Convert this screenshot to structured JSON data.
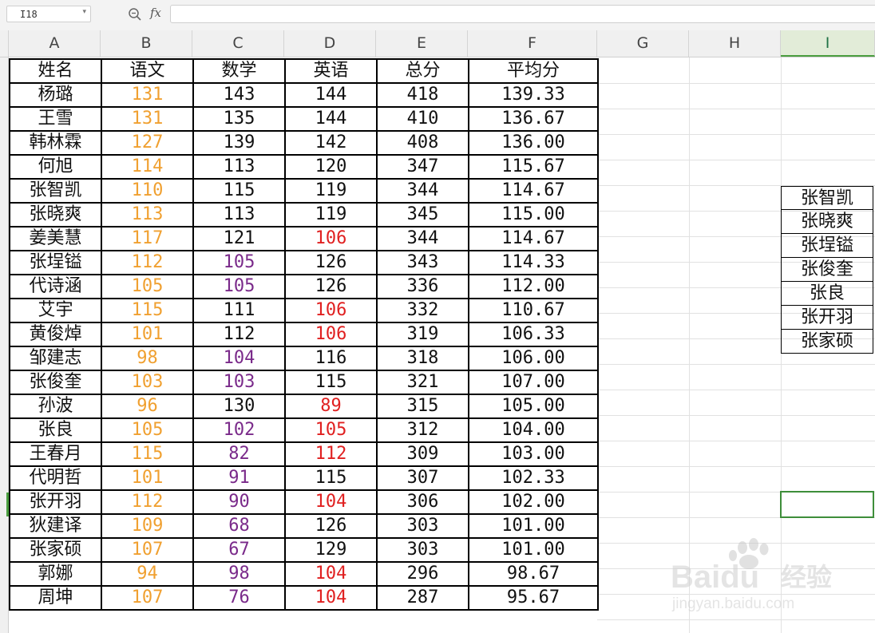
{
  "formula_bar": {
    "name_box_value": "I18",
    "fx_label": "fx",
    "formula_value": ""
  },
  "columns": [
    "A",
    "B",
    "C",
    "D",
    "E",
    "F",
    "G",
    "H",
    "I"
  ],
  "active_column": "I",
  "table": {
    "headers": [
      "姓名",
      "语文",
      "数学",
      "英语",
      "总分",
      "平均分"
    ],
    "rows": [
      [
        "杨璐",
        "131",
        "143",
        "144",
        "418",
        "139.33"
      ],
      [
        "王雪",
        "131",
        "135",
        "144",
        "410",
        "136.67"
      ],
      [
        "韩林霖",
        "127",
        "139",
        "142",
        "408",
        "136.00"
      ],
      [
        "何旭",
        "114",
        "113",
        "120",
        "347",
        "115.67"
      ],
      [
        "张智凯",
        "110",
        "115",
        "119",
        "344",
        "114.67"
      ],
      [
        "张晓爽",
        "113",
        "113",
        "119",
        "345",
        "115.00"
      ],
      [
        "姜美慧",
        "117",
        "121",
        "106",
        "344",
        "114.67"
      ],
      [
        "张埕镒",
        "112",
        "105",
        "126",
        "343",
        "114.33"
      ],
      [
        "代诗涵",
        "105",
        "105",
        "126",
        "336",
        "112.00"
      ],
      [
        "艾宇",
        "115",
        "111",
        "106",
        "332",
        "110.67"
      ],
      [
        "黄俊焯",
        "101",
        "112",
        "106",
        "319",
        "106.33"
      ],
      [
        "邹建志",
        "98",
        "104",
        "116",
        "318",
        "106.00"
      ],
      [
        "张俊奎",
        "103",
        "103",
        "115",
        "321",
        "107.00"
      ],
      [
        "孙波",
        "96",
        "130",
        "89",
        "315",
        "105.00"
      ],
      [
        "张良",
        "105",
        "102",
        "105",
        "312",
        "104.00"
      ],
      [
        "王春月",
        "115",
        "82",
        "112",
        "309",
        "103.00"
      ],
      [
        "代明哲",
        "101",
        "91",
        "115",
        "307",
        "102.33"
      ],
      [
        "张开羽",
        "112",
        "90",
        "104",
        "306",
        "102.00"
      ],
      [
        "狄建译",
        "109",
        "68",
        "126",
        "303",
        "101.00"
      ],
      [
        "张家硕",
        "107",
        "67",
        "129",
        "303",
        "101.00"
      ],
      [
        "郭娜",
        "94",
        "98",
        "104",
        "296",
        "98.67"
      ],
      [
        "周坤",
        "107",
        "76",
        "104",
        "287",
        "95.67"
      ]
    ],
    "colors": {
      "rows": [
        [
          "",
          "orange",
          "",
          "",
          "",
          ""
        ],
        [
          "",
          "orange",
          "",
          "",
          "",
          ""
        ],
        [
          "",
          "orange",
          "",
          "",
          "",
          ""
        ],
        [
          "",
          "orange",
          "",
          "",
          "",
          ""
        ],
        [
          "",
          "orange",
          "",
          "",
          "",
          ""
        ],
        [
          "",
          "orange",
          "",
          "",
          "",
          ""
        ],
        [
          "",
          "orange",
          "",
          "red",
          "",
          ""
        ],
        [
          "",
          "orange",
          "purple",
          "",
          "",
          ""
        ],
        [
          "",
          "orange",
          "purple",
          "",
          "",
          ""
        ],
        [
          "",
          "orange",
          "",
          "red",
          "",
          ""
        ],
        [
          "",
          "orange",
          "",
          "red",
          "",
          ""
        ],
        [
          "",
          "orange",
          "purple",
          "",
          "",
          ""
        ],
        [
          "",
          "orange",
          "purple",
          "",
          "",
          ""
        ],
        [
          "",
          "orange",
          "",
          "red",
          "",
          ""
        ],
        [
          "",
          "orange",
          "purple",
          "red",
          "",
          ""
        ],
        [
          "",
          "orange",
          "purple",
          "red",
          "",
          ""
        ],
        [
          "",
          "orange",
          "purple",
          "",
          "",
          ""
        ],
        [
          "",
          "orange",
          "purple",
          "red",
          "",
          ""
        ],
        [
          "",
          "orange",
          "purple",
          "",
          "",
          ""
        ],
        [
          "",
          "orange",
          "purple",
          "",
          "",
          ""
        ],
        [
          "",
          "orange",
          "purple",
          "red",
          "",
          ""
        ],
        [
          "",
          "orange",
          "purple",
          "red",
          "",
          ""
        ]
      ],
      "palette": {
        "orange": "#f0a030",
        "purple": "#7a2a8a",
        "red": "#e02020"
      }
    }
  },
  "name_list": [
    "张智凯",
    "张晓爽",
    "张埕镒",
    "张俊奎",
    "张良",
    "张开羽",
    "张家硕"
  ],
  "watermark": {
    "brand": "Baidu",
    "brand_cn": "经验",
    "url": "jingyan.baidu.com"
  },
  "theme": {
    "selection_green": "#3e8e3a",
    "header_bg": "#f0f0f0"
  }
}
